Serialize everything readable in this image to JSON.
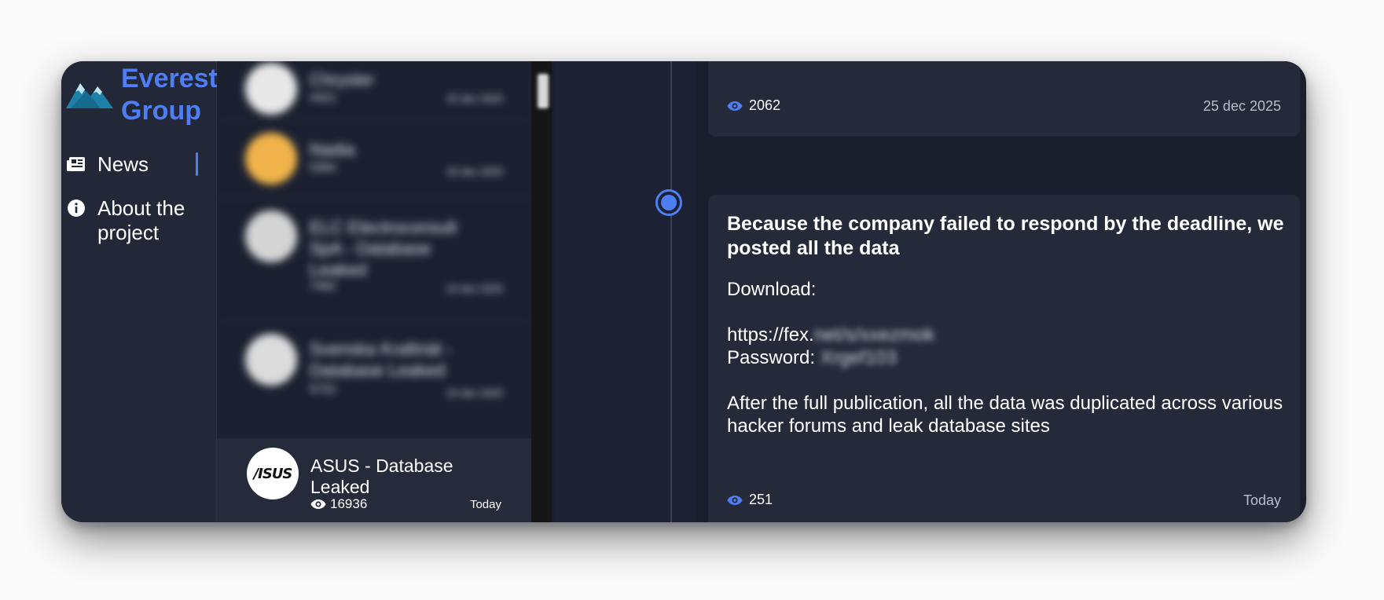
{
  "brand": {
    "name_line1": "Everest",
    "name_line2": "Group",
    "color": "#4f7df3"
  },
  "nav": {
    "news_label": "News",
    "about_label": "About the project"
  },
  "list": {
    "items": [
      {
        "title": "Chrysler",
        "views": "4421",
        "date": "25 dec 2025"
      },
      {
        "title": "Nadia",
        "views": "5364",
        "date": "25 dec 2025"
      },
      {
        "title": "ELC Electroconsult SpA - Database Leaked",
        "views": "7462",
        "date": "24 dec 2025"
      },
      {
        "title": "Svenska Kraftnät - Database Leaked",
        "views": "5722",
        "date": "24 dec 2025"
      }
    ],
    "active": {
      "title": "ASUS - Database Leaked",
      "views": "16936",
      "date": "Today",
      "logo_text": "/ISUS"
    }
  },
  "cards": [
    {
      "views": "2062",
      "date": "25 dec 2025"
    },
    {
      "title": "Because the company failed to respond by the deadline, we posted all the data",
      "download_label": "Download:",
      "link_prefix": "https://fex.",
      "link_redacted": "net/s/xxezmok",
      "password_label": "Password:",
      "password_redacted": "Xrgef103",
      "body_text": "After the full publication, all the data was duplicated across various hacker forums and leak database sites",
      "views": "251",
      "date": "Today"
    }
  ]
}
